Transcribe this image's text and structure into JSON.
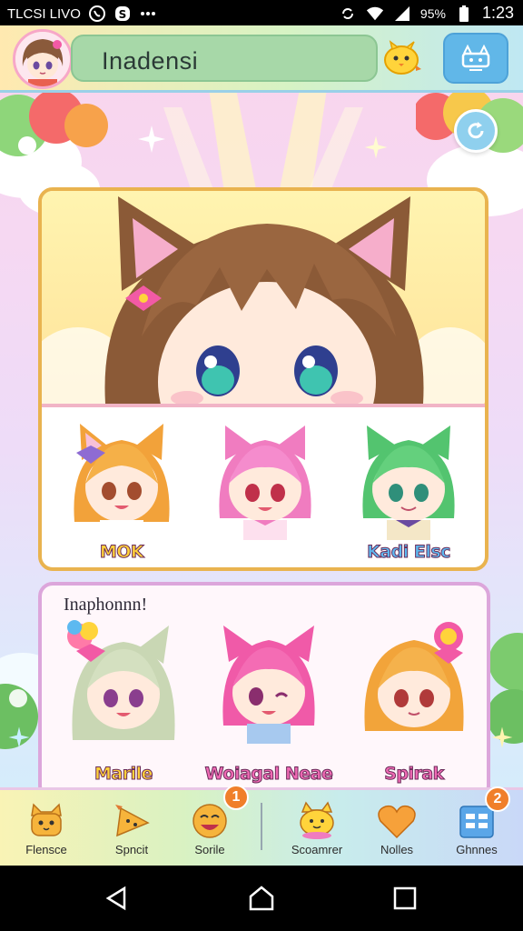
{
  "status_bar": {
    "left_text": "TLCSI LIVO",
    "battery_text": "95%",
    "time": "1:23",
    "icons": [
      "viber-icon",
      "skype-icon",
      "more-icon",
      "sync-icon",
      "wifi-icon",
      "signal-icon",
      "battery-icon"
    ]
  },
  "top_bar": {
    "search_text": "Inadensi",
    "avatar_icon": "anime-girl-avatar",
    "mascot_icon": "yellow-chick-icon",
    "action_icon": "cat-ears-icon"
  },
  "featured_card": {
    "hero_icon": "cat-girl-portrait",
    "thumbnails": [
      {
        "label": "MOK",
        "label_color": "#ffd23a",
        "hair": "#f2a23a"
      },
      {
        "label": "",
        "label_color": "#ffffff",
        "hair": "#f07cc0"
      },
      {
        "label": "Kadi Elsc",
        "label_color": "#5db9f0",
        "hair": "#53c46f"
      }
    ]
  },
  "second_card": {
    "title": "Inaphonnn!",
    "thumbnails": [
      {
        "label": "Marile",
        "label_color": "#ffd23a",
        "hair": "#c9d7b4"
      },
      {
        "label": "Woiagal Neae",
        "label_color": "#f06ab4",
        "hair": "#f05aa8"
      },
      {
        "label": "Spirak",
        "label_color": "#f06ab4",
        "hair": "#f2a43a"
      }
    ]
  },
  "bottom_nav": {
    "items": [
      {
        "label": "Flensce",
        "icon": "cat-face-icon"
      },
      {
        "label": "Spncit",
        "icon": "pencil-cat-icon"
      },
      {
        "label": "Sorile",
        "icon": "smiley-icon",
        "badge": "1"
      },
      {
        "label": "Scoamrer",
        "icon": "cat-bowl-icon"
      },
      {
        "label": "Nolles",
        "icon": "heart-icon"
      },
      {
        "label": "Ghnnes",
        "icon": "grid-calendar-icon",
        "badge": "2"
      }
    ]
  },
  "system_nav": {
    "icons": [
      "back-icon",
      "home-icon",
      "recents-icon"
    ]
  },
  "colors": {
    "accent_blue": "#61b7e8",
    "card_border": "#e9b34f",
    "badge_orange": "#f07f2a"
  }
}
